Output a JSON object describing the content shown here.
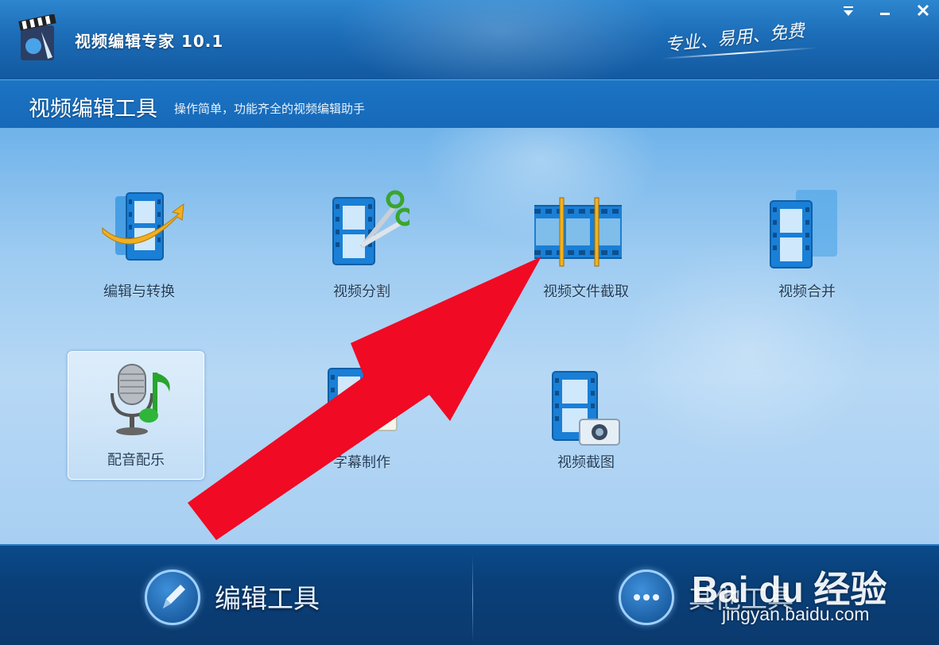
{
  "app": {
    "title": "视频编辑专家  10.1",
    "slogan": "专业、易用、免费"
  },
  "window_controls": {
    "menu": "⏷",
    "minimize": "—",
    "close": "✕"
  },
  "section": {
    "title": "视频编辑工具",
    "subtitle": "操作简单，功能齐全的视频编辑助手"
  },
  "tools": [
    {
      "label": "编辑与转换",
      "icon": "film-convert-icon"
    },
    {
      "label": "视频分割",
      "icon": "film-scissors-icon"
    },
    {
      "label": "视频文件截取",
      "icon": "film-clip-icon"
    },
    {
      "label": "视频合并",
      "icon": "film-merge-icon"
    },
    {
      "label": "配音配乐",
      "icon": "microphone-music-icon",
      "selected": true
    },
    {
      "label": "字幕制作",
      "icon": "subtitle-icon"
    },
    {
      "label": "视频截图",
      "icon": "film-camera-icon"
    }
  ],
  "bottom_tabs": [
    {
      "label": "编辑工具",
      "icon": "pencil-icon",
      "active": true
    },
    {
      "label": "其他工具",
      "icon": "more-dots-icon",
      "active": false
    }
  ],
  "watermark": {
    "logo": "Bai du 经验",
    "url": "jingyan.baidu.com"
  },
  "colors": {
    "title_bar": "#1c6cb7",
    "main_bg": "#9dcbf1",
    "bottom_bar": "#0a3f78",
    "arrow": "#f00a24"
  }
}
